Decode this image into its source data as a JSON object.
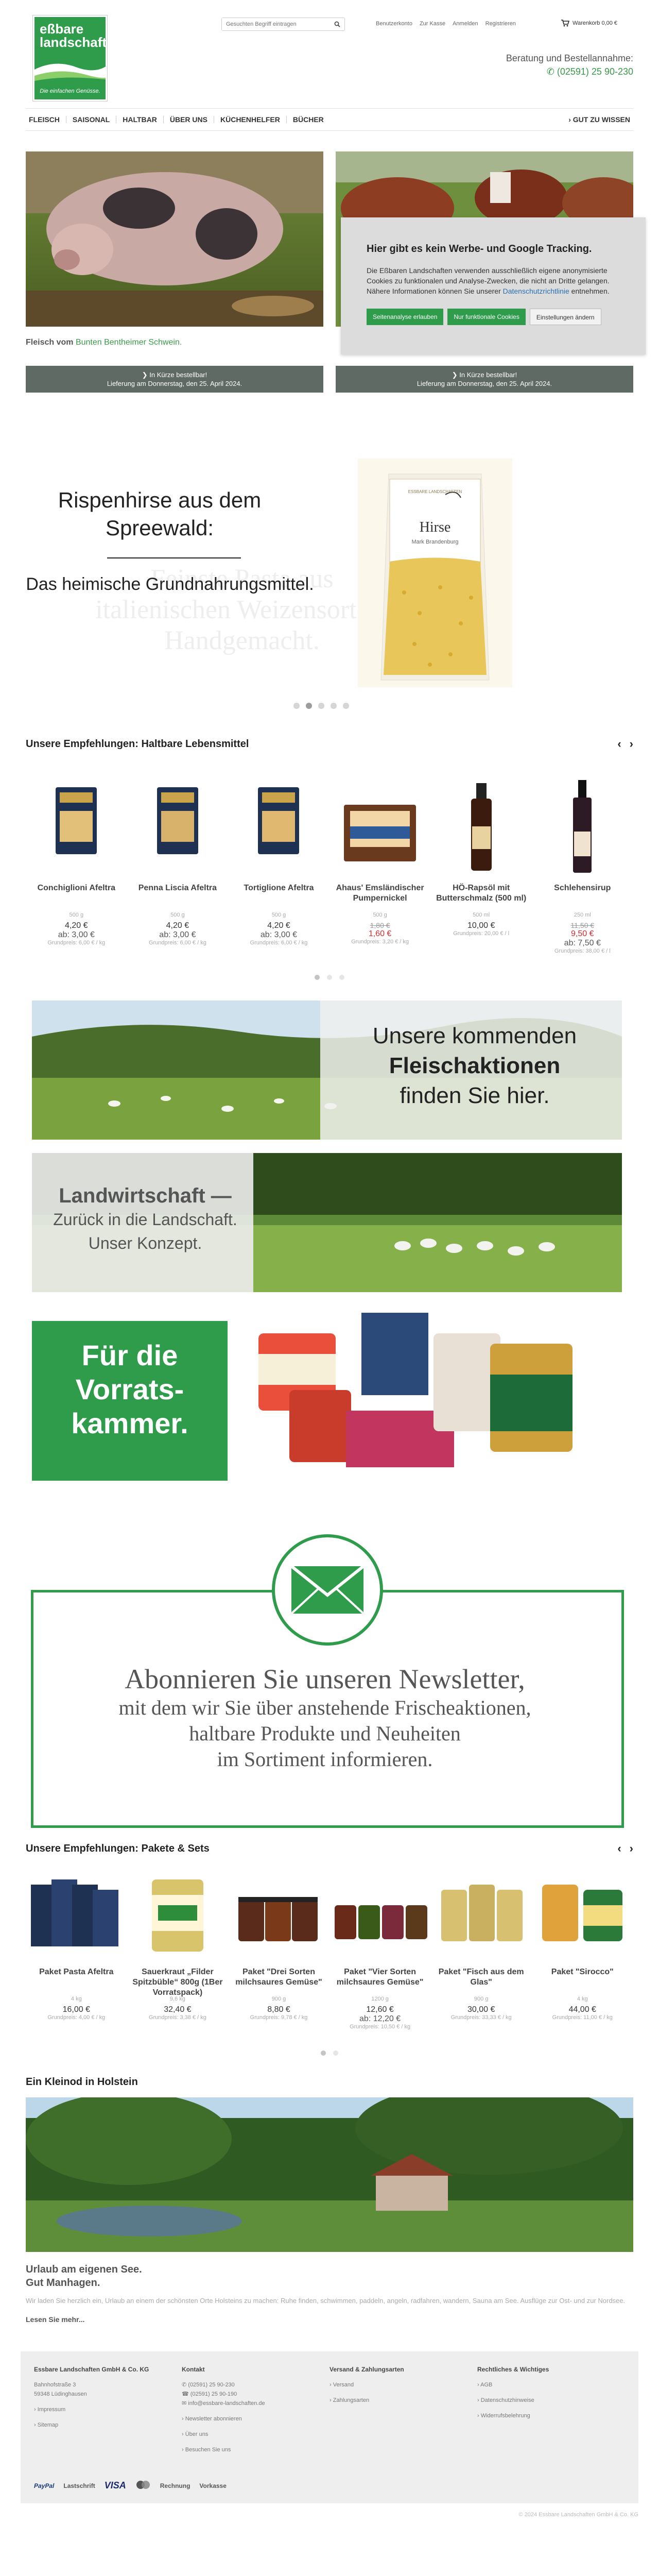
{
  "brand": {
    "name_line1": "eßbare",
    "name_line2": "landschaften",
    "tagline": "Die einfachen Genüsse."
  },
  "header": {
    "search_placeholder": "Gesuchten Begriff eintragen",
    "top_links": [
      "Benutzerkonto",
      "Zur Kasse",
      "Anmelden",
      "Registrieren"
    ],
    "cart_label": "Warenkorb 0,00 €",
    "advice_label": "Beratung und Bestellannahme:",
    "phone": "(02591) 25 90-230"
  },
  "nav": {
    "items": [
      "FLEISCH",
      "SAISONAL",
      "HALTBAR",
      "ÜBER UNS",
      "KÜCHENHELFER",
      "BÜCHER"
    ],
    "right": "› GUT ZU WISSEN"
  },
  "hero": {
    "caption_prefix": "Fleisch vom",
    "caption_highlight": "Bunten Bentheimer Schwein.",
    "order_line1": "❯ In Kürze bestellbar!",
    "order_line2": "Lieferung am Donnerstag, den 25. April 2024."
  },
  "cookie": {
    "title": "Hier gibt es kein Werbe- und Google Tracking.",
    "text": "Die Eßbaren Landschaften verwenden ausschließlich eigene anonymisierte Cookies zu funktionalen und Analyse-Zwecken, die nicht an Dritte gelangen. Nähere Informationen können Sie unserer",
    "link": "Datenschutzrichtlinie",
    "text_end": "entnehmen.",
    "buttons": [
      "Seitenanalyse erlauben",
      "Nur funktionale Cookies",
      "Einstellungen ändern"
    ]
  },
  "slider": {
    "title": "Rispenhirse aus dem Spreewald:",
    "subtitle": "Das heimische Grundnahrungsmittel.",
    "ghost": "Feinste Pasta aus italienischen Weizensorten. Handgemacht.",
    "bag_title": "Hirse",
    "bag_sub": "Mark Brandenburg",
    "bag_brand": "ESSBARE LANDSCHAFTEN"
  },
  "haltbar": {
    "title": "Unsere Empfehlungen: Haltbare Lebensmittel",
    "products": [
      {
        "name": "Conchiglioni Afeltra",
        "unit": "500 g",
        "price": "4,20 €",
        "ab": "ab: 3,00 €",
        "base": "Grundpreis: 6,00 € / kg"
      },
      {
        "name": "Penna Liscia Afeltra",
        "unit": "500 g",
        "price": "4,20 €",
        "ab": "ab: 3,00 €",
        "base": "Grundpreis: 6,00 € / kg"
      },
      {
        "name": "Tortiglione Afeltra",
        "unit": "500 g",
        "price": "4,20 €",
        "ab": "ab: 3,00 €",
        "base": "Grundpreis: 6,00 € / kg"
      },
      {
        "name": "Ahaus' Emsländischer Pumpernickel",
        "unit": "500 g",
        "old": "1,80 €",
        "sale": "1,60 €",
        "base": "Grundpreis: 3,20 € / kg"
      },
      {
        "name": "HÖ-Rapsöl mit Butterschmalz (500 ml)",
        "unit": "500 ml",
        "price": "10,00 €",
        "base": "Grundpreis: 20,00 € / l"
      },
      {
        "name": "Schlehensirup",
        "unit": "250 ml",
        "old": "11,50 €",
        "sale": "9,50 €",
        "ab": "ab: 7,50 €",
        "base": "Grundpreis: 38,00 € / l"
      }
    ]
  },
  "banners": {
    "fleisch_l1": "Unsere kommenden",
    "fleisch_l2": "Fleischaktionen",
    "fleisch_l3": "finden Sie hier.",
    "landw_l1": "Landwirtschaft —",
    "landw_l2": "Zurück in die Landschaft.",
    "landw_l3": "Unser Konzept.",
    "vorrat": "Für die Vorrats-kammer."
  },
  "newsletter": {
    "line1": "Abonnieren Sie unseren Newsletter,",
    "line2": "mit dem wir Sie über anstehende Frischeaktionen,",
    "line3": "haltbare Produkte und Neuheiten",
    "line4": "im Sortiment informieren."
  },
  "pakete": {
    "title": "Unsere Empfehlungen: Pakete & Sets",
    "products": [
      {
        "name": "Paket Pasta Afeltra",
        "unit": "4 kg",
        "price": "16,00 €",
        "base": "Grundpreis: 4,00 € / kg"
      },
      {
        "name": "Sauerkraut „Filder Spitzbüble“ 800g (1Ber Vorratspack)",
        "unit": "9,6 kg",
        "price": "32,40 €",
        "base": "Grundpreis: 3,38 € / kg"
      },
      {
        "name": "Paket \"Drei Sorten milchsaures Gemüse\"",
        "unit": "900 g",
        "price": "8,80 €",
        "base": "Grundpreis: 9,78 € / kg"
      },
      {
        "name": "Paket \"Vier Sorten milchsaures Gemüse\"",
        "unit": "1200 g",
        "price": "12,60 €",
        "ab": "ab: 12,20 €",
        "base": "Grundpreis: 10,50 € / kg"
      },
      {
        "name": "Paket \"Fisch aus dem Glas\"",
        "unit": "900 g",
        "price": "30,00 €",
        "base": "Grundpreis: 33,33 € / kg"
      },
      {
        "name": "Paket \"Sirocco\"",
        "unit": "4 kg",
        "price": "44,00 €",
        "base": "Grundpreis: 11,00 € / kg"
      }
    ]
  },
  "holstein": {
    "title": "Ein Kleinod in Holstein",
    "sub1": "Urlaub am eigenen See.",
    "sub2": "Gut Manhagen.",
    "desc": "Wir laden Sie herzlich ein, Urlaub an einem der schönsten Orte Holsteins zu machen: Ruhe finden, schwimmen, paddeln, angeln, radfahren, wandern, Sauna am See. Ausflüge zur Ost- und zur Nordsee.",
    "more": "Lesen Sie mehr..."
  },
  "footer": {
    "company": {
      "title": "Essbare Landschaften GmbH & Co. KG",
      "lines": [
        "Bahnhofstraße 3",
        "59348 Lüdinghausen"
      ],
      "links": [
        "Impressum",
        "Sitemap"
      ]
    },
    "contact": {
      "title": "Kontakt",
      "lines": [
        "(02591) 25 90-230",
        "(02591) 25 90-190",
        "info@essbare-landschaften.de"
      ],
      "links": [
        "Newsletter abonnieren",
        "Über uns",
        "Besuchen Sie uns"
      ]
    },
    "shipping": {
      "title": "Versand & Zahlungsarten",
      "links": [
        "Versand",
        "Zahlungsarten"
      ]
    },
    "legal": {
      "title": "Rechtliches & Wichtiges",
      "links": [
        "AGB",
        "Datenschutzhinweise",
        "Widerrufsbelehrung"
      ]
    },
    "payments": [
      "PayPal",
      "Lastschrift",
      "VISA",
      "MasterCard",
      "Rechnung",
      "Vorkasse"
    ],
    "copyright": "© 2024 Essbare Landschaften GmbH & Co. KG"
  },
  "colors": {
    "brand_green": "#2e9c4b",
    "button_gray": "#5f6a64",
    "sale_red": "#d42a2a"
  }
}
